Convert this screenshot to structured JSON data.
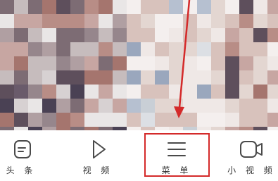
{
  "colors": {
    "annotation_red": "#d42a2a",
    "icon_stroke": "#4a4a4a",
    "tab_background": "#ffffff"
  },
  "tab_bar": {
    "tabs": [
      {
        "label": "头 条",
        "icon": "news-icon"
      },
      {
        "label": "视 频",
        "icon": "play-icon"
      },
      {
        "label": "菜 单",
        "icon": "menu-icon"
      },
      {
        "label": "小 视 频",
        "icon": "video-camera-icon"
      }
    ]
  },
  "annotation": {
    "highlighted_tab": "菜 单",
    "arrow": "red arrow pointing down to the menu tab"
  }
}
